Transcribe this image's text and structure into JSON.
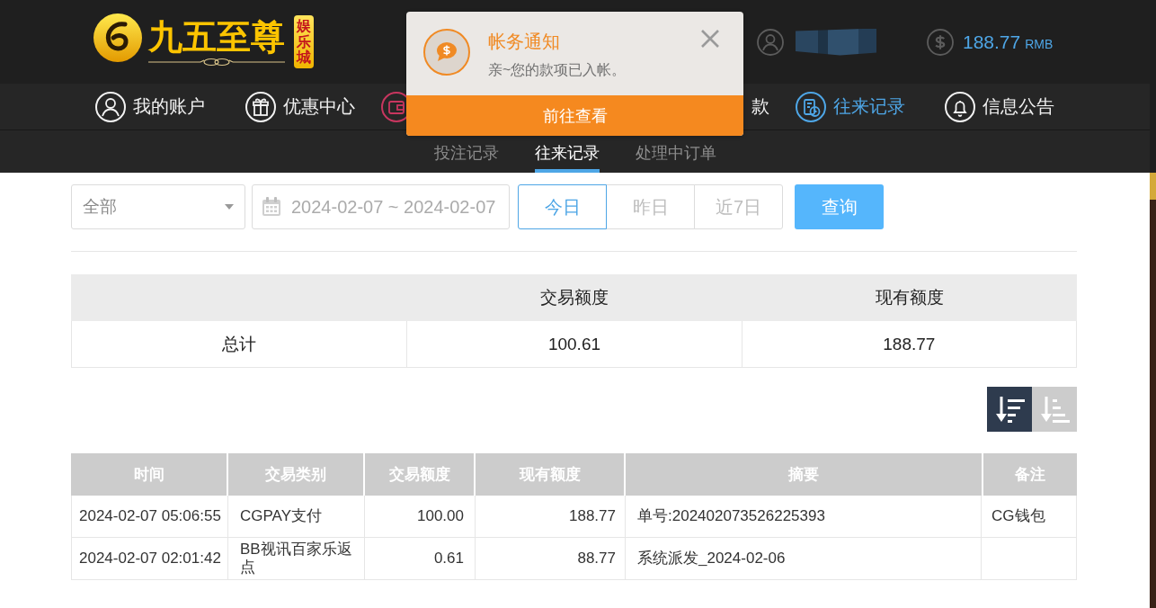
{
  "header": {
    "logo": {
      "name": "九五至尊",
      "badge": "娱乐城"
    },
    "balance": {
      "amount": "188.77",
      "currency": "RMB"
    }
  },
  "nav": {
    "left": [
      {
        "kind": "user",
        "label": "我的账户",
        "selected": false
      },
      {
        "kind": "gift",
        "label": "优惠中心",
        "selected": false
      },
      {
        "kind": "wallet",
        "selected": false
      }
    ],
    "right": [
      {
        "label": "款",
        "selected": false
      },
      {
        "kind": "records",
        "label": "往来记录",
        "selected": true
      },
      {
        "kind": "bell",
        "label": "信息公告",
        "selected": false
      }
    ]
  },
  "subtabs": [
    {
      "label": "投注记录",
      "selected": false
    },
    {
      "label": "往来记录",
      "selected": true
    },
    {
      "label": "处理中订单",
      "selected": false
    }
  ],
  "filters": {
    "type_select": {
      "value": "全部"
    },
    "date_range": {
      "value": "2024-02-07 ~ 2024-02-07"
    },
    "quick_ranges": [
      {
        "label": "今日",
        "selected": true
      },
      {
        "label": "昨日",
        "selected": false
      },
      {
        "label": "近7日",
        "selected": false
      }
    ],
    "query_button": "查询"
  },
  "summary": {
    "columns": [
      "交易额度",
      "现有额度"
    ],
    "rows": [
      {
        "label": "总计",
        "values": [
          "100.61",
          "188.77"
        ]
      }
    ]
  },
  "sort_buttons": [
    {
      "kind": "descending",
      "selected": true
    },
    {
      "kind": "ascending",
      "selected": false
    }
  ],
  "records": {
    "columns": [
      "时间",
      "交易类别",
      "交易额度",
      "现有额度",
      "摘要",
      "备注"
    ],
    "rows": [
      {
        "time": "2024-02-07 05:06:55",
        "type": "CGPAY支付",
        "amount": "100.00",
        "balance": "188.77",
        "summary": "单号:202402073526225393",
        "note": "CG钱包"
      },
      {
        "time": "2024-02-07 02:01:42",
        "type": "BB视讯百家乐返点",
        "amount": "0.61",
        "balance": "88.77",
        "summary": "系统派发_2024-02-06"
      }
    ]
  },
  "notification": {
    "title": "帐务通知",
    "message": "亲~您的款项已入帐。",
    "action": "前往查看"
  }
}
